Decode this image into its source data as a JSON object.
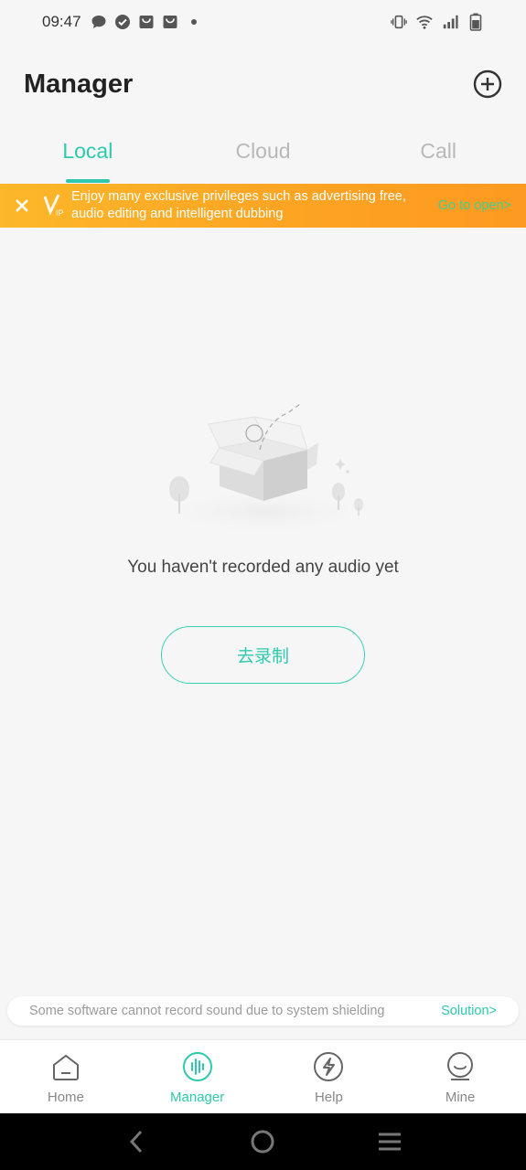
{
  "status_bar": {
    "time": "09:47",
    "left_icons": [
      "message-icon",
      "check-circle-icon",
      "mail-bag-icon",
      "shopping-bag-icon",
      "dot-icon"
    ],
    "right_icons": [
      "vibrate-icon",
      "wifi-icon",
      "signal-icon",
      "battery-icon"
    ]
  },
  "header": {
    "title": "Manager",
    "add_icon": "plus-circle-icon"
  },
  "tabs": [
    {
      "label": "Local",
      "active": true
    },
    {
      "label": "Cloud",
      "active": false
    },
    {
      "label": "Call",
      "active": false
    }
  ],
  "vip_banner": {
    "close_icon": "close-icon",
    "badge_icon": "vip-icon",
    "text": "Enjoy many exclusive privileges such as advertising free, audio editing and intelligent dubbing",
    "link": "Go to open>"
  },
  "empty_state": {
    "illustration": "empty-box-icon",
    "message": "You haven't recorded any audio yet",
    "button_label": "去录制"
  },
  "notice": {
    "text": "Some software cannot record sound due to system shielding",
    "link": "Solution>"
  },
  "bottom_nav": [
    {
      "label": "Home",
      "icon": "home-icon",
      "active": false
    },
    {
      "label": "Manager",
      "icon": "audio-wave-icon",
      "active": true
    },
    {
      "label": "Help",
      "icon": "lightning-icon",
      "active": false
    },
    {
      "label": "Mine",
      "icon": "smile-icon",
      "active": false
    }
  ],
  "colors": {
    "accent": "#2ec9ad",
    "banner_orange": "#fda423",
    "background": "#f6f6f6"
  }
}
